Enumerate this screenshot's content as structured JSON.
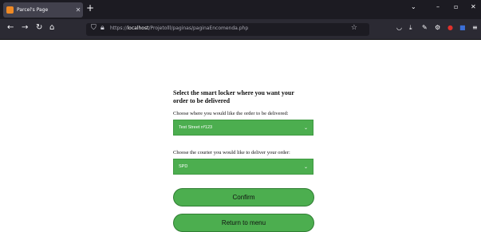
{
  "browser": {
    "tab_title": "Parcel's Page",
    "new_tab_icon": "+",
    "url_prefix": "https://",
    "url_host": "localhost",
    "url_path": "/Projetolll/paginas/paginaEncomenda.php"
  },
  "page": {
    "heading_line1": "Select the smart locker where you want your",
    "heading_line2": "order to be delivered",
    "locker_label": "Choose where you would like the order to be delivered:",
    "locker_value": "Test Street nº123",
    "courier_label": "Choose the courier you would like to deliver your order:",
    "courier_value": "SPD",
    "confirm_label": "Confirm",
    "return_label": "Return to menu"
  },
  "colors": {
    "accent_green": "#4cae4f",
    "chrome_dark": "#1c1b22",
    "toolbar": "#2b2a33"
  }
}
